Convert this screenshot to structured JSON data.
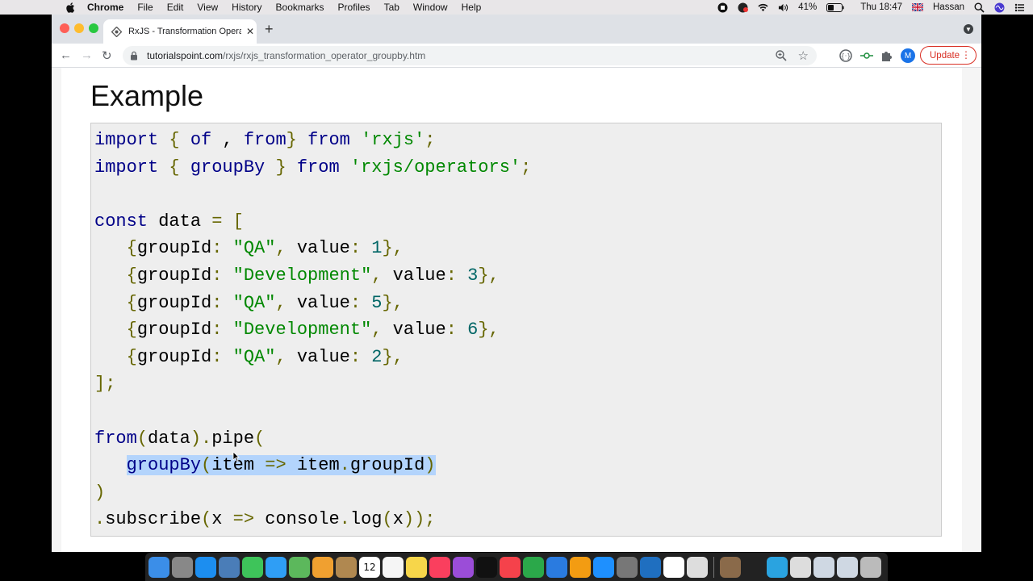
{
  "menubar": {
    "app": "Chrome",
    "items": [
      "File",
      "Edit",
      "View",
      "History",
      "Bookmarks",
      "Profiles",
      "Tab",
      "Window",
      "Help"
    ],
    "battery": "41%",
    "clock": "Thu 18:47",
    "user": "Hassan"
  },
  "browser": {
    "tab_title": "RxJS - Transformation Operato",
    "url_host": "tutorialspoint.com",
    "url_path": "/rxjs/rxjs_transformation_operator_groupby.htm",
    "profile_initial": "M",
    "update_label": "Update"
  },
  "page": {
    "heading": "Example",
    "code_lines": [
      [
        [
          "kw",
          "import"
        ],
        [
          "id",
          " "
        ],
        [
          "pn",
          "{"
        ],
        [
          "id",
          " "
        ],
        [
          "kw",
          "of"
        ],
        [
          "id",
          " , "
        ],
        [
          "kw",
          "from"
        ],
        [
          "pn",
          "}"
        ],
        [
          "id",
          " "
        ],
        [
          "kw",
          "from"
        ],
        [
          "id",
          " "
        ],
        [
          "str",
          "'rxjs'"
        ],
        [
          "pn",
          ";"
        ]
      ],
      [
        [
          "kw",
          "import"
        ],
        [
          "id",
          " "
        ],
        [
          "pn",
          "{"
        ],
        [
          "id",
          " "
        ],
        [
          "kw",
          "groupBy"
        ],
        [
          "id",
          " "
        ],
        [
          "pn",
          "}"
        ],
        [
          "id",
          " "
        ],
        [
          "kw",
          "from"
        ],
        [
          "id",
          " "
        ],
        [
          "str",
          "'rxjs/operators'"
        ],
        [
          "pn",
          ";"
        ]
      ],
      [],
      [
        [
          "kw",
          "const"
        ],
        [
          "id",
          " data "
        ],
        [
          "pn",
          "="
        ],
        [
          "id",
          " "
        ],
        [
          "pn",
          "["
        ]
      ],
      [
        [
          "id",
          "   "
        ],
        [
          "pn",
          "{"
        ],
        [
          "id",
          "groupId"
        ],
        [
          "pn",
          ":"
        ],
        [
          "id",
          " "
        ],
        [
          "str",
          "\"QA\""
        ],
        [
          "pn",
          ","
        ],
        [
          "id",
          " value"
        ],
        [
          "pn",
          ":"
        ],
        [
          "id",
          " "
        ],
        [
          "num",
          "1"
        ],
        [
          "pn",
          "},"
        ]
      ],
      [
        [
          "id",
          "   "
        ],
        [
          "pn",
          "{"
        ],
        [
          "id",
          "groupId"
        ],
        [
          "pn",
          ":"
        ],
        [
          "id",
          " "
        ],
        [
          "str",
          "\"Development\""
        ],
        [
          "pn",
          ","
        ],
        [
          "id",
          " value"
        ],
        [
          "pn",
          ":"
        ],
        [
          "id",
          " "
        ],
        [
          "num",
          "3"
        ],
        [
          "pn",
          "},"
        ]
      ],
      [
        [
          "id",
          "   "
        ],
        [
          "pn",
          "{"
        ],
        [
          "id",
          "groupId"
        ],
        [
          "pn",
          ":"
        ],
        [
          "id",
          " "
        ],
        [
          "str",
          "\"QA\""
        ],
        [
          "pn",
          ","
        ],
        [
          "id",
          " value"
        ],
        [
          "pn",
          ":"
        ],
        [
          "id",
          " "
        ],
        [
          "num",
          "5"
        ],
        [
          "pn",
          "},"
        ]
      ],
      [
        [
          "id",
          "   "
        ],
        [
          "pn",
          "{"
        ],
        [
          "id",
          "groupId"
        ],
        [
          "pn",
          ":"
        ],
        [
          "id",
          " "
        ],
        [
          "str",
          "\"Development\""
        ],
        [
          "pn",
          ","
        ],
        [
          "id",
          " value"
        ],
        [
          "pn",
          ":"
        ],
        [
          "id",
          " "
        ],
        [
          "num",
          "6"
        ],
        [
          "pn",
          "},"
        ]
      ],
      [
        [
          "id",
          "   "
        ],
        [
          "pn",
          "{"
        ],
        [
          "id",
          "groupId"
        ],
        [
          "pn",
          ":"
        ],
        [
          "id",
          " "
        ],
        [
          "str",
          "\"QA\""
        ],
        [
          "pn",
          ","
        ],
        [
          "id",
          " value"
        ],
        [
          "pn",
          ":"
        ],
        [
          "id",
          " "
        ],
        [
          "num",
          "2"
        ],
        [
          "pn",
          "},"
        ]
      ],
      [
        [
          "pn",
          "];"
        ]
      ],
      [],
      [
        [
          "kw",
          "from"
        ],
        [
          "pn",
          "("
        ],
        [
          "id",
          "data"
        ],
        [
          "pn",
          ")."
        ],
        [
          "id",
          "pipe"
        ],
        [
          "pn",
          "("
        ]
      ],
      [
        [
          "id",
          "   "
        ],
        [
          "hl-kw",
          "groupBy"
        ],
        [
          "hl-pn",
          "("
        ],
        [
          "hl-id",
          "item "
        ],
        [
          "hl-pn",
          "=>"
        ],
        [
          "hl-id",
          " item"
        ],
        [
          "hl-pn",
          "."
        ],
        [
          "hl-id",
          "groupId"
        ],
        [
          "hl-pn",
          ")"
        ]
      ],
      [
        [
          "pn",
          ")"
        ]
      ],
      [
        [
          "pn",
          "."
        ],
        [
          "id",
          "subscribe"
        ],
        [
          "pn",
          "("
        ],
        [
          "id",
          "x "
        ],
        [
          "pn",
          "=>"
        ],
        [
          "id",
          " console"
        ],
        [
          "pn",
          "."
        ],
        [
          "id",
          "log"
        ],
        [
          "pn",
          "("
        ],
        [
          "id",
          "x"
        ],
        [
          "pn",
          "));"
        ]
      ]
    ]
  },
  "dock": {
    "calendar_day": "12",
    "apps": [
      "finder-icon",
      "launchpad-icon",
      "safari-icon",
      "preview-icon",
      "facetime-icon",
      "messages-icon",
      "maps-icon",
      "photos-icon",
      "contacts-icon",
      "calendar-icon",
      "reminders-icon",
      "notes-icon",
      "music-icon",
      "podcasts-icon",
      "appletv-icon",
      "news-icon",
      "numbers-icon",
      "keynote-icon",
      "pages-icon",
      "appstore-icon",
      "systemprefs-icon",
      "vscode-icon",
      "chrome-icon",
      "utility-icon"
    ],
    "apps_right": [
      "files-icon",
      "terminal-icon",
      "telegram-icon",
      "cat-icon",
      "screens-icon",
      "screens2-icon",
      "trash-icon"
    ]
  }
}
